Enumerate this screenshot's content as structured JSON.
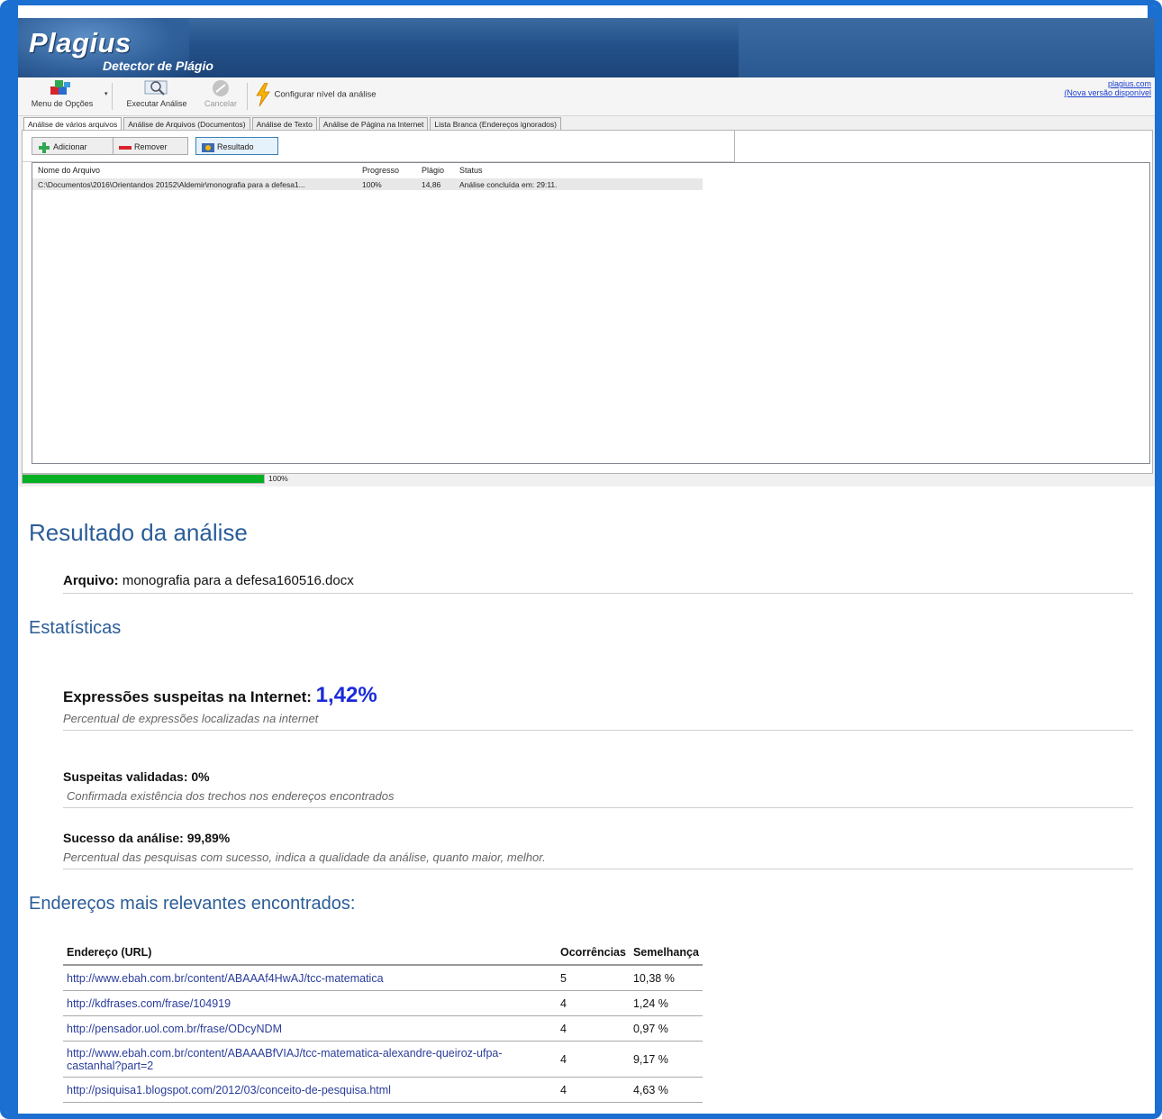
{
  "app": {
    "logo": "Plagius",
    "logo_sub": "Detector de Plágio"
  },
  "toolbar": {
    "menu_label": "Menu de Opções",
    "execute_label": "Executar Análise",
    "cancel_label": "Cancelar",
    "configure_label": "Configurar nível da análise",
    "site_link": "plagius.com",
    "update_link": "(Nova versão disponível"
  },
  "tabs": [
    "Análise de vários arquivos",
    "Análise de Arquivos (Documentos)",
    "Análise de Texto",
    "Análise de Página na Internet",
    "Lista Branca (Endereços ignorados)"
  ],
  "actions": {
    "add": "Adicionar",
    "remove": "Remover",
    "result": "Resultado"
  },
  "file_list": {
    "headers": [
      "Nome do Arquivo",
      "Progresso",
      "Plágio",
      "Status"
    ],
    "rows": [
      [
        "C:\\Documentos\\2016\\Orientandos 20152\\Aldemir\\monografia para a defesa1...",
        "100%",
        "14,86",
        "Análise concluída em: 29:11."
      ]
    ]
  },
  "progress": {
    "value": 1.0,
    "label": "100%"
  },
  "report": {
    "title": "Resultado da análise",
    "file_label": "Arquivo:",
    "file_name": "monografia para a defesa160516.docx",
    "stats_title": "Estatísticas",
    "internet_label": "Expressões suspeitas na Internet:",
    "internet_value": "1,42%",
    "internet_desc": "Percentual de expressões localizadas na internet",
    "validated_label": "Suspeitas validadas: 0%",
    "validated_desc": "Confirmada existência dos trechos nos endereços encontrados",
    "success_label": "Sucesso da análise: 99,89%",
    "success_desc": "Percentual das pesquisas com sucesso, indica a qualidade da análise, quanto maior, melhor.",
    "urls_title": "Endereços mais relevantes encontrados:",
    "url_headers": [
      "Endereço (URL)",
      "Ocorrências",
      "Semelhança"
    ],
    "urls": [
      [
        "http://www.ebah.com.br/content/ABAAAf4HwAJ/tcc-matematica",
        "5",
        "10,38 %"
      ],
      [
        "http://kdfrases.com/frase/104919",
        "4",
        "1,24 %"
      ],
      [
        "http://pensador.uol.com.br/frase/ODcyNDM",
        "4",
        "0,97 %"
      ],
      [
        "http://www.ebah.com.br/content/ABAAABfVIAJ/tcc-matematica-alexandre-queiroz-ufpa-castanhal?part=2",
        "4",
        "9,17 %"
      ],
      [
        "http://psiquisa1.blogspot.com/2012/03/conceito-de-pesquisa.html",
        "4",
        "4,63 %"
      ]
    ]
  }
}
